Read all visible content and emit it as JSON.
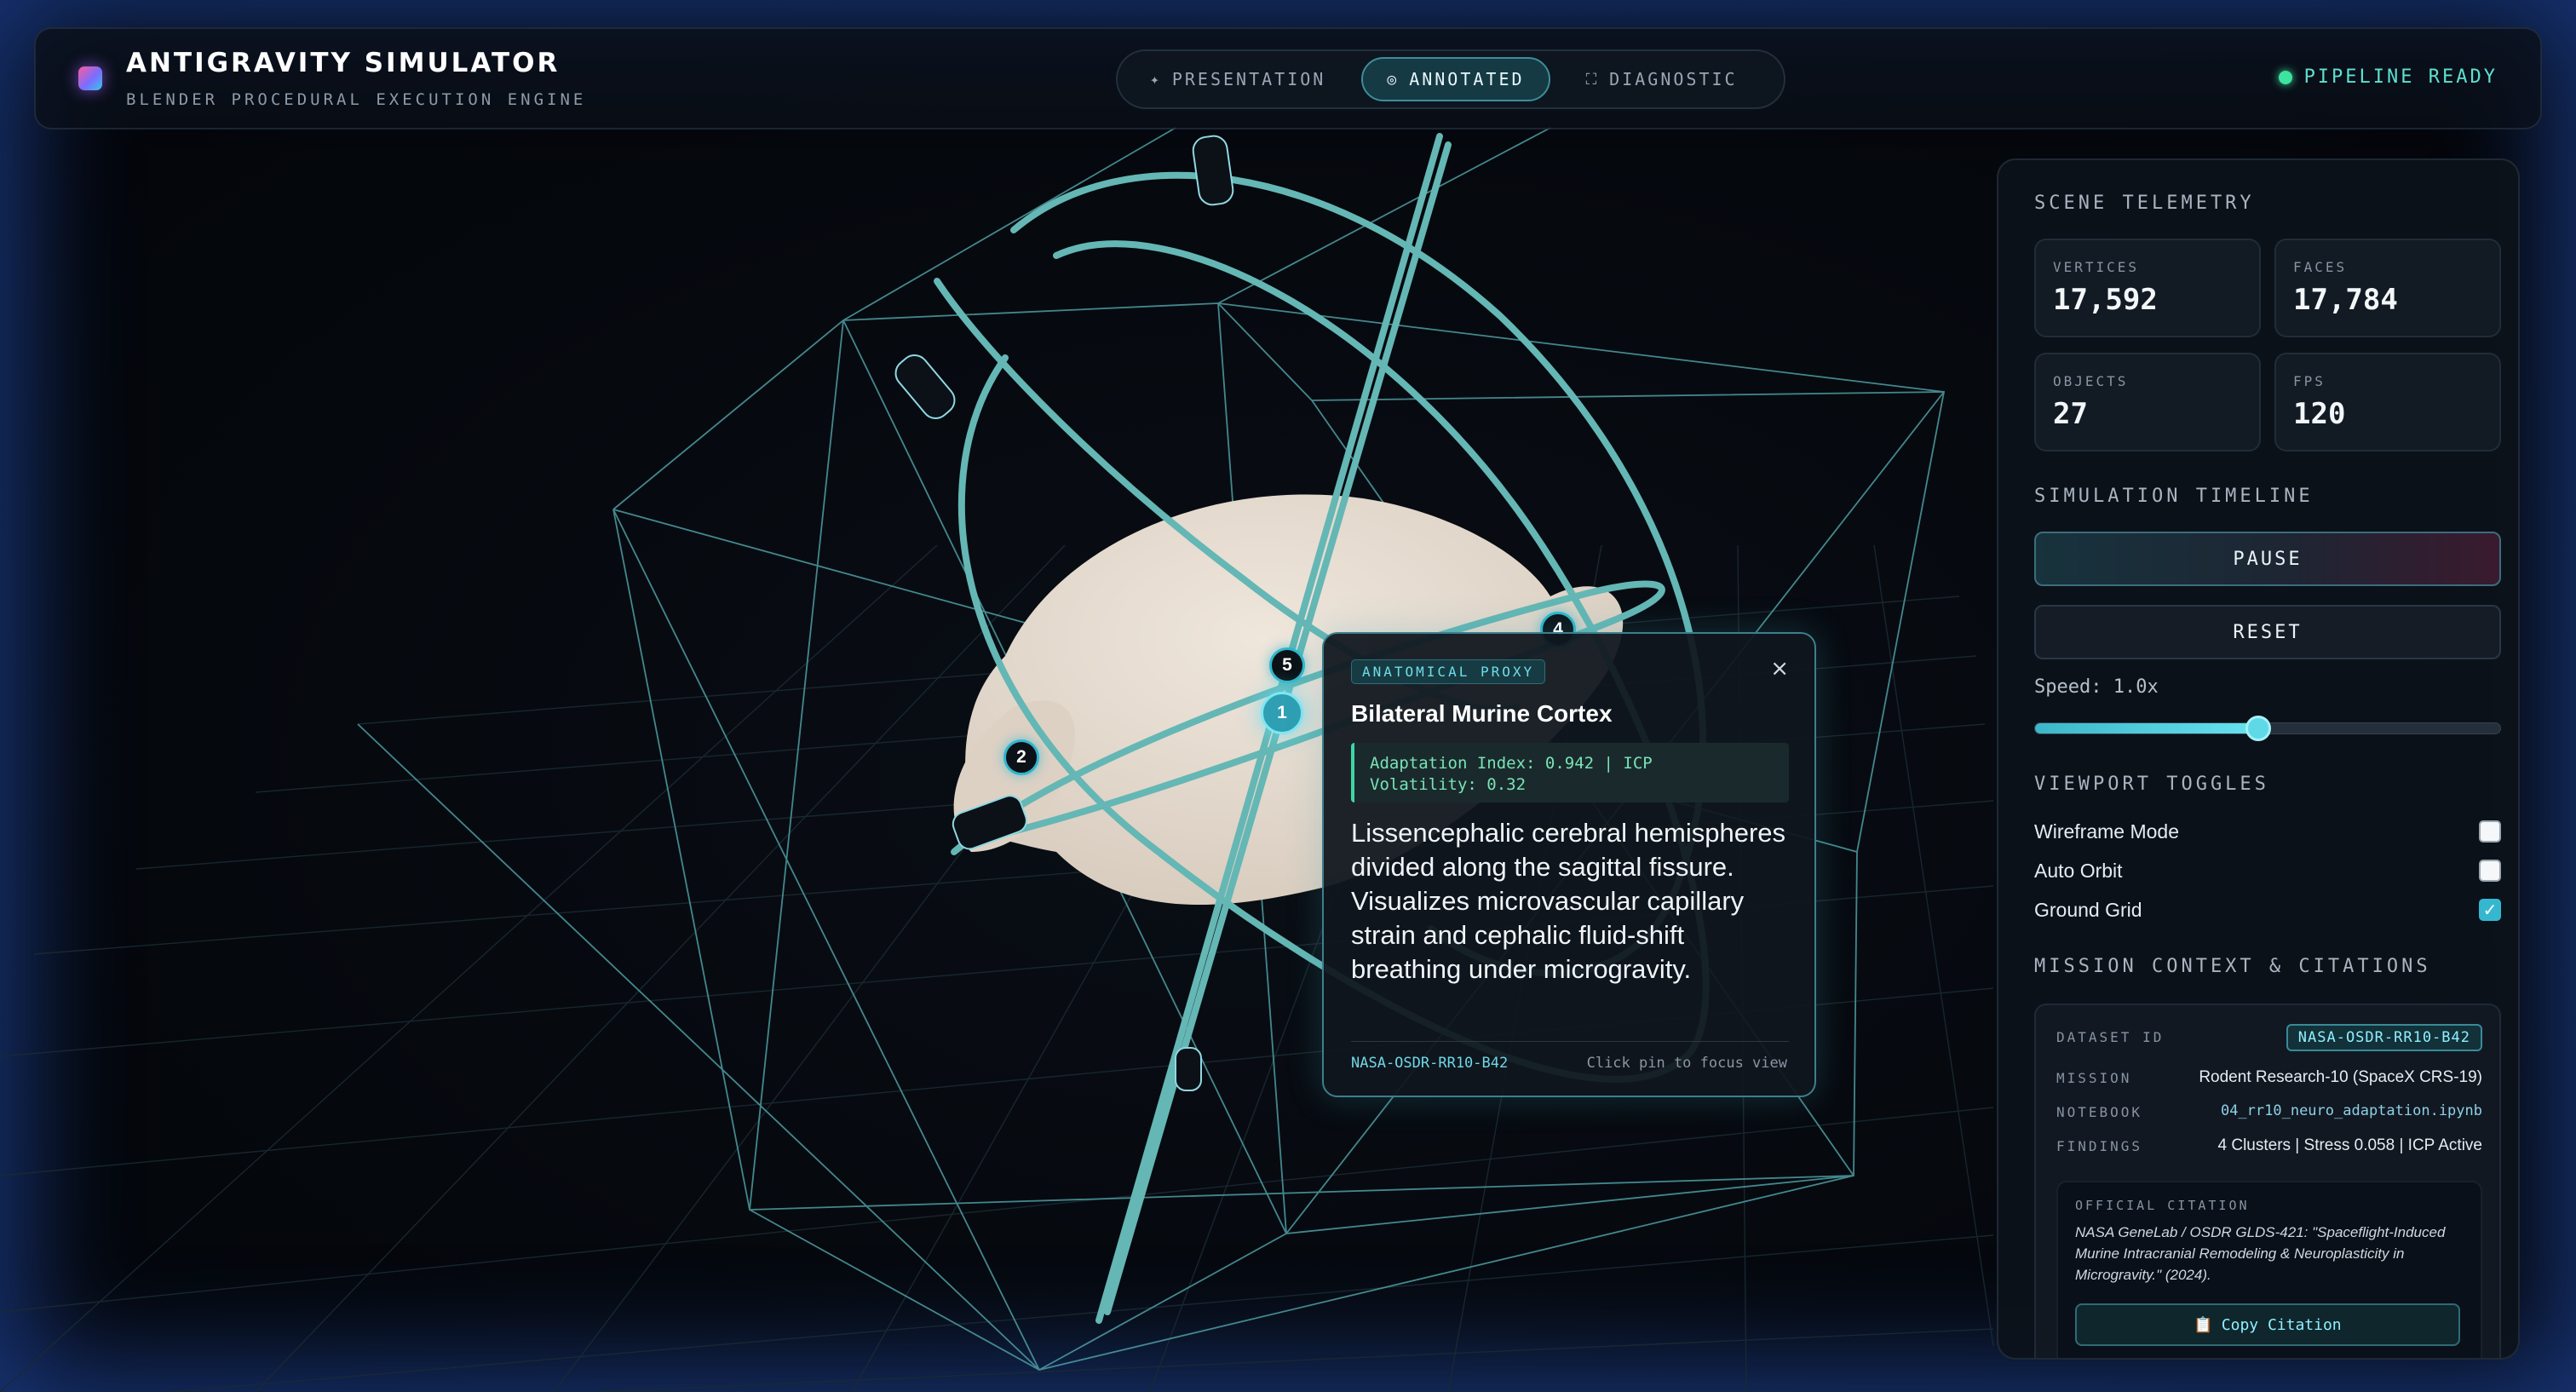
{
  "app": {
    "title": "ANTIGRAVITY SIMULATOR",
    "subtitle": "BLENDER PROCEDURAL EXECUTION ENGINE"
  },
  "modes": [
    {
      "label": "PRESENTATION",
      "icon": "sparkle-icon",
      "glyph": "✦",
      "active": false
    },
    {
      "label": "ANNOTATED",
      "icon": "target-icon",
      "glyph": "◎",
      "active": true
    },
    {
      "label": "DIAGNOSTIC",
      "icon": "frame-icon",
      "glyph": "⛶",
      "active": false
    }
  ],
  "status": {
    "label": "PIPELINE READY",
    "color": "#3fe3a0"
  },
  "telemetry": {
    "title": "SCENE TELEMETRY",
    "stats": [
      {
        "label": "VERTICES",
        "value": "17,592"
      },
      {
        "label": "FACES",
        "value": "17,784"
      },
      {
        "label": "OBJECTS",
        "value": "27"
      },
      {
        "label": "FPS",
        "value": "120"
      }
    ]
  },
  "timeline": {
    "title": "SIMULATION TIMELINE",
    "pause_label": "PAUSE",
    "reset_label": "RESET",
    "speed_label": "Speed: 1.0x",
    "speed_fraction": 0.48
  },
  "toggles": {
    "title": "VIEWPORT TOGGLES",
    "items": [
      {
        "label": "Wireframe Mode",
        "checked": false
      },
      {
        "label": "Auto Orbit",
        "checked": false
      },
      {
        "label": "Ground Grid",
        "checked": true
      }
    ]
  },
  "context": {
    "title": "MISSION CONTEXT & CITATIONS",
    "dataset_key": "DATASET ID",
    "dataset_value": "NASA-OSDR-RR10-B42",
    "mission_key": "MISSION",
    "mission_value": "Rodent Research-10 (SpaceX CRS-19)",
    "notebook_key": "NOTEBOOK",
    "notebook_value": "04_rr10_neuro_adaptation.ipynb",
    "findings_key": "FINDINGS",
    "findings_value": "4 Clusters | Stress 0.058 | ICP Active",
    "citation_label": "OFFICIAL CITATION",
    "citation_text": "NASA GeneLab / OSDR GLDS-421: \"Spaceflight-Induced Murine Intracranial Remodeling & Neuroplasticity in Microgravity.\" (2024).",
    "copy_label": "Copy Citation",
    "copy_glyph": "📋"
  },
  "popup": {
    "tag": "ANATOMICAL PROXY",
    "close_glyph": "×",
    "title": "Bilateral Murine Cortex",
    "metric_line1": "Adaptation Index: 0.942 | ICP",
    "metric_line2": "Volatility: 0.32",
    "description": "Lissencephalic cerebral hemispheres divided along the sagittal fissure. Visualizes microvascular capillary strain and cephalic fluid-shift breathing under microgravity.",
    "dataset": "NASA-OSDR-RR10-B42",
    "hint": "Click pin to focus view"
  },
  "pins": [
    {
      "label": "5"
    },
    {
      "label": "1"
    },
    {
      "label": "2"
    },
    {
      "label": "4"
    }
  ],
  "colors": {
    "accent": "#5fd8e8",
    "wire": "#6fc7c6",
    "brain": "#e8ddd2"
  }
}
